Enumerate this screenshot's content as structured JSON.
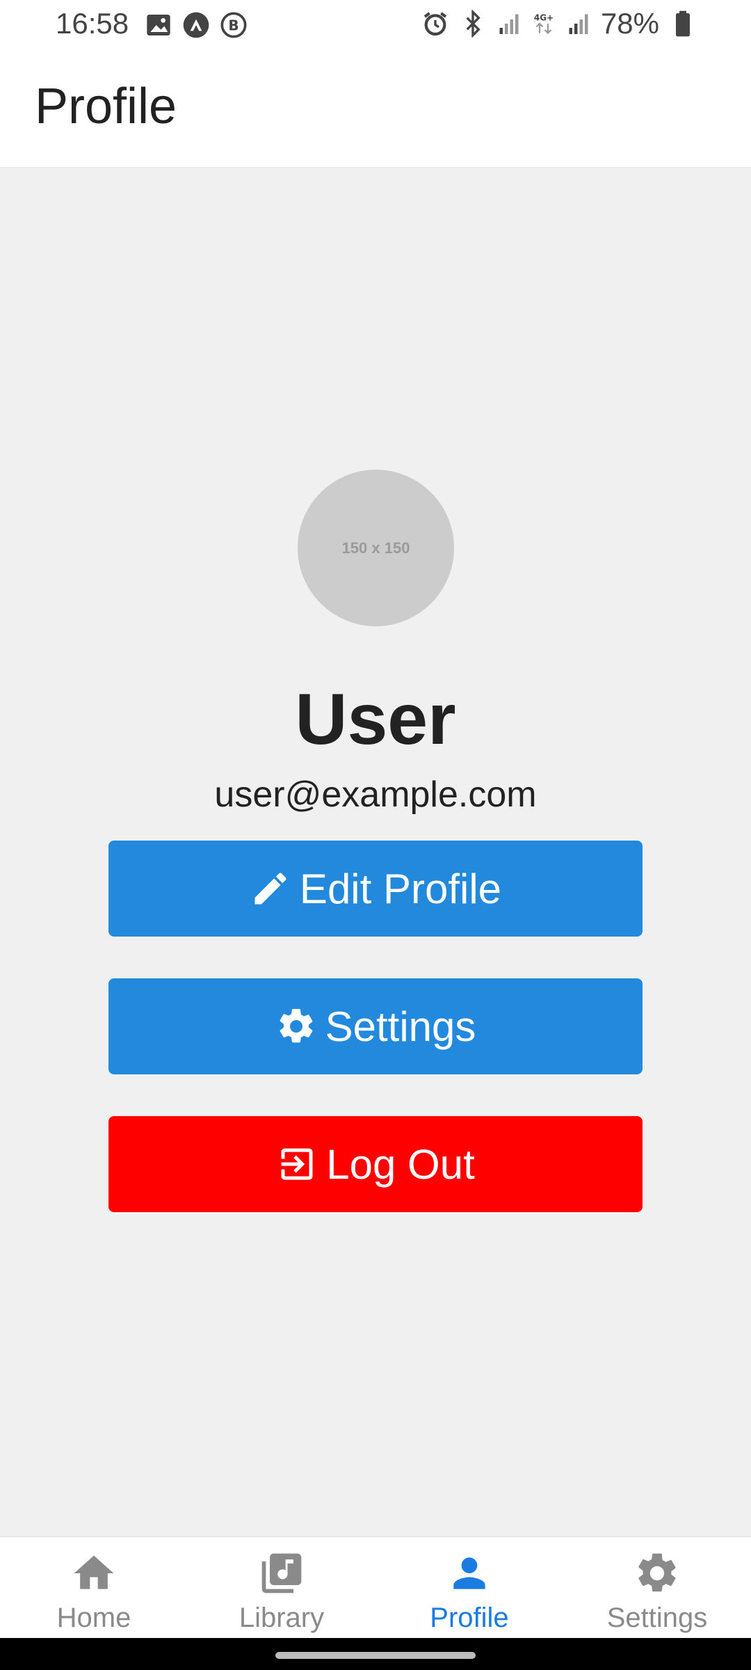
{
  "status_bar": {
    "time": "16:58",
    "battery": "78%",
    "left_icons": [
      "image-icon",
      "app-icon",
      "b-icon"
    ],
    "right_icons": [
      "alarm-icon",
      "bluetooth-icon",
      "signal-icon",
      "data-4g-icon",
      "signal-icon",
      "battery-icon"
    ]
  },
  "app_bar": {
    "title": "Profile"
  },
  "profile": {
    "avatar_placeholder": "150 x 150",
    "name": "User",
    "email": "user@example.com"
  },
  "actions": {
    "edit_profile": "Edit Profile",
    "settings": "Settings",
    "log_out": "Log Out"
  },
  "tabs": [
    {
      "label": "Home",
      "icon": "home-icon"
    },
    {
      "label": "Library",
      "icon": "library-icon"
    },
    {
      "label": "Profile",
      "icon": "person-icon",
      "active": true
    },
    {
      "label": "Settings",
      "icon": "gear-icon"
    }
  ],
  "colors": {
    "primary_button": "#2289dc",
    "danger_button": "#ff0000",
    "active_tab": "#1a7be0"
  }
}
